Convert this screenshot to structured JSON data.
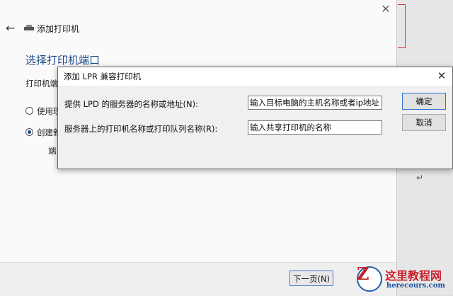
{
  "wizard": {
    "close_glyph": "✕",
    "back_glyph": "←",
    "title": "添加打印机",
    "heading": "选择打印机端口",
    "sub_text": "打印机端",
    "radio_use_existing": "使用现",
    "radio_create_new": "创建新",
    "port_label": "端",
    "next_button": "下一页(N)"
  },
  "dialog": {
    "title": "添加 LPR 兼容打印机",
    "close_glyph": "✕",
    "server_label": "提供 LPD 的服务器的名称或地址(N):",
    "server_value": "输入目标电脑的主机名称或者ip地址",
    "queue_label": "服务器上的打印机名称或打印队列名称(R):",
    "queue_value": "输入共享打印机的名称",
    "ok_button": "确定",
    "cancel_button": "取消"
  },
  "background": {
    "return_glyph": "↵"
  },
  "watermark": {
    "site_name": "这里教程网",
    "site_url": "herecours.com"
  }
}
